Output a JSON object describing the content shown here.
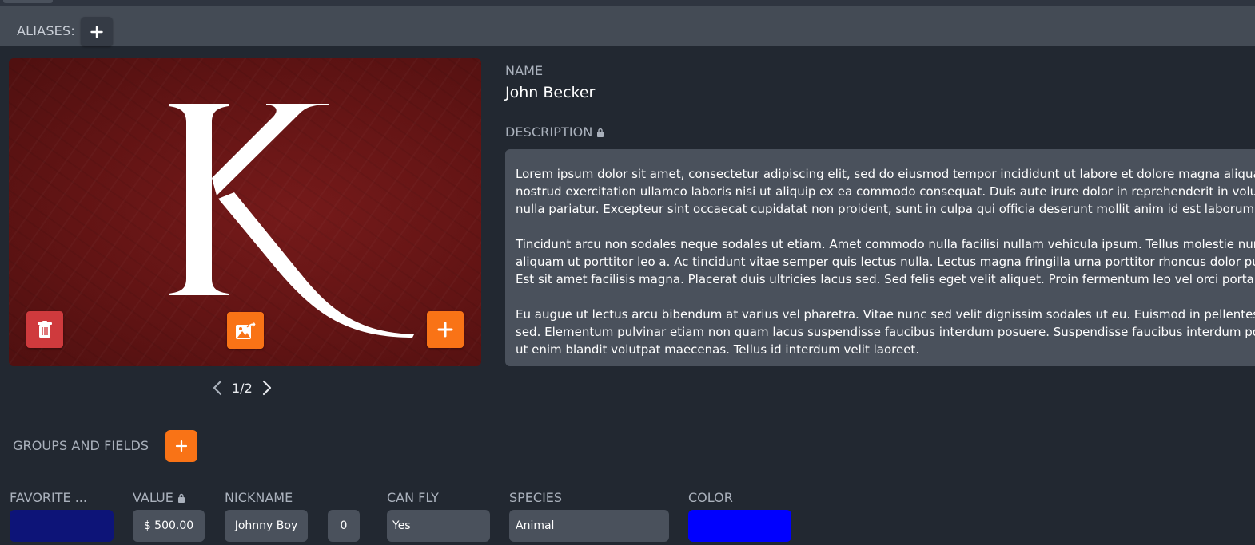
{
  "aliases": {
    "label": "ALIASES:",
    "add_icon": "plus-icon"
  },
  "image_card": {
    "letter": "K",
    "background_color": "#621414",
    "pager": {
      "current": 1,
      "total": 2,
      "text": "1/2"
    },
    "buttons": {
      "delete_icon": "trash-icon",
      "change_icon": "image-share-icon",
      "add_icon": "plus-icon"
    }
  },
  "name": {
    "label": "NAME",
    "value": "John Becker"
  },
  "description": {
    "label": "DESCRIPTION",
    "locked_icon": "lock-icon",
    "paragraphs": [
      "Lorem ipsum dolor sit amet, consectetur adipiscing elit, sed do eiusmod tempor incididunt ut labore et dolore magna aliqua. Ut e",
      "nostrud exercitation ullamco laboris nisi ut aliquip ex ea commodo consequat. Duis aute irure dolor in reprehenderit in voluptate",
      "nulla pariatur. Excepteur sint occaecat cupidatat non proident, sunt in culpa qui officia deserunt mollit anim id est laborum.",
      "Tincidunt arcu non sodales neque sodales ut etiam. Amet commodo nulla facilisi nullam vehicula ipsum. Tellus molestie nunc nor",
      "aliquam ut porttitor leo a. Ac tincidunt vitae semper quis lectus nulla. Lectus magna fringilla urna porttitor rhoncus dolor purus. J",
      "Est sit amet facilisis magna. Placerat duis ultricies lacus sed. Sed felis eget velit aliquet. Proin fermentum leo vel orci porta non p",
      "Eu augue ut lectus arcu bibendum at varius vel pharetra. Vitae nunc sed velit dignissim sodales ut eu. Euismod in pellentesque m",
      "sed. Elementum pulvinar etiam non quam lacus suspendisse faucibus interdum posuere. Suspendisse faucibus interdum posuere",
      "ut enim blandit volutpat maecenas. Tellus id interdum velit laoreet."
    ]
  },
  "groups": {
    "label": "GROUPS AND FIELDS",
    "add_icon": "plus-icon"
  },
  "fields": {
    "favorite": {
      "label": "FAVORITE ...",
      "color": "#0d1478"
    },
    "value": {
      "label": "VALUE",
      "text": "$ 500.00"
    },
    "nickname": {
      "label": "NICKNAME",
      "text": "Johnny Boy",
      "count": "0"
    },
    "can_fly": {
      "label": "CAN FLY",
      "text": "Yes"
    },
    "species": {
      "label": "SPECIES",
      "text": "Animal"
    },
    "color": {
      "label": "COLOR",
      "color": "#0000ff"
    }
  },
  "colors": {
    "accent": "#f97316",
    "danger": "#cf3a3d",
    "panel": "#4a515c",
    "background": "#222831"
  }
}
